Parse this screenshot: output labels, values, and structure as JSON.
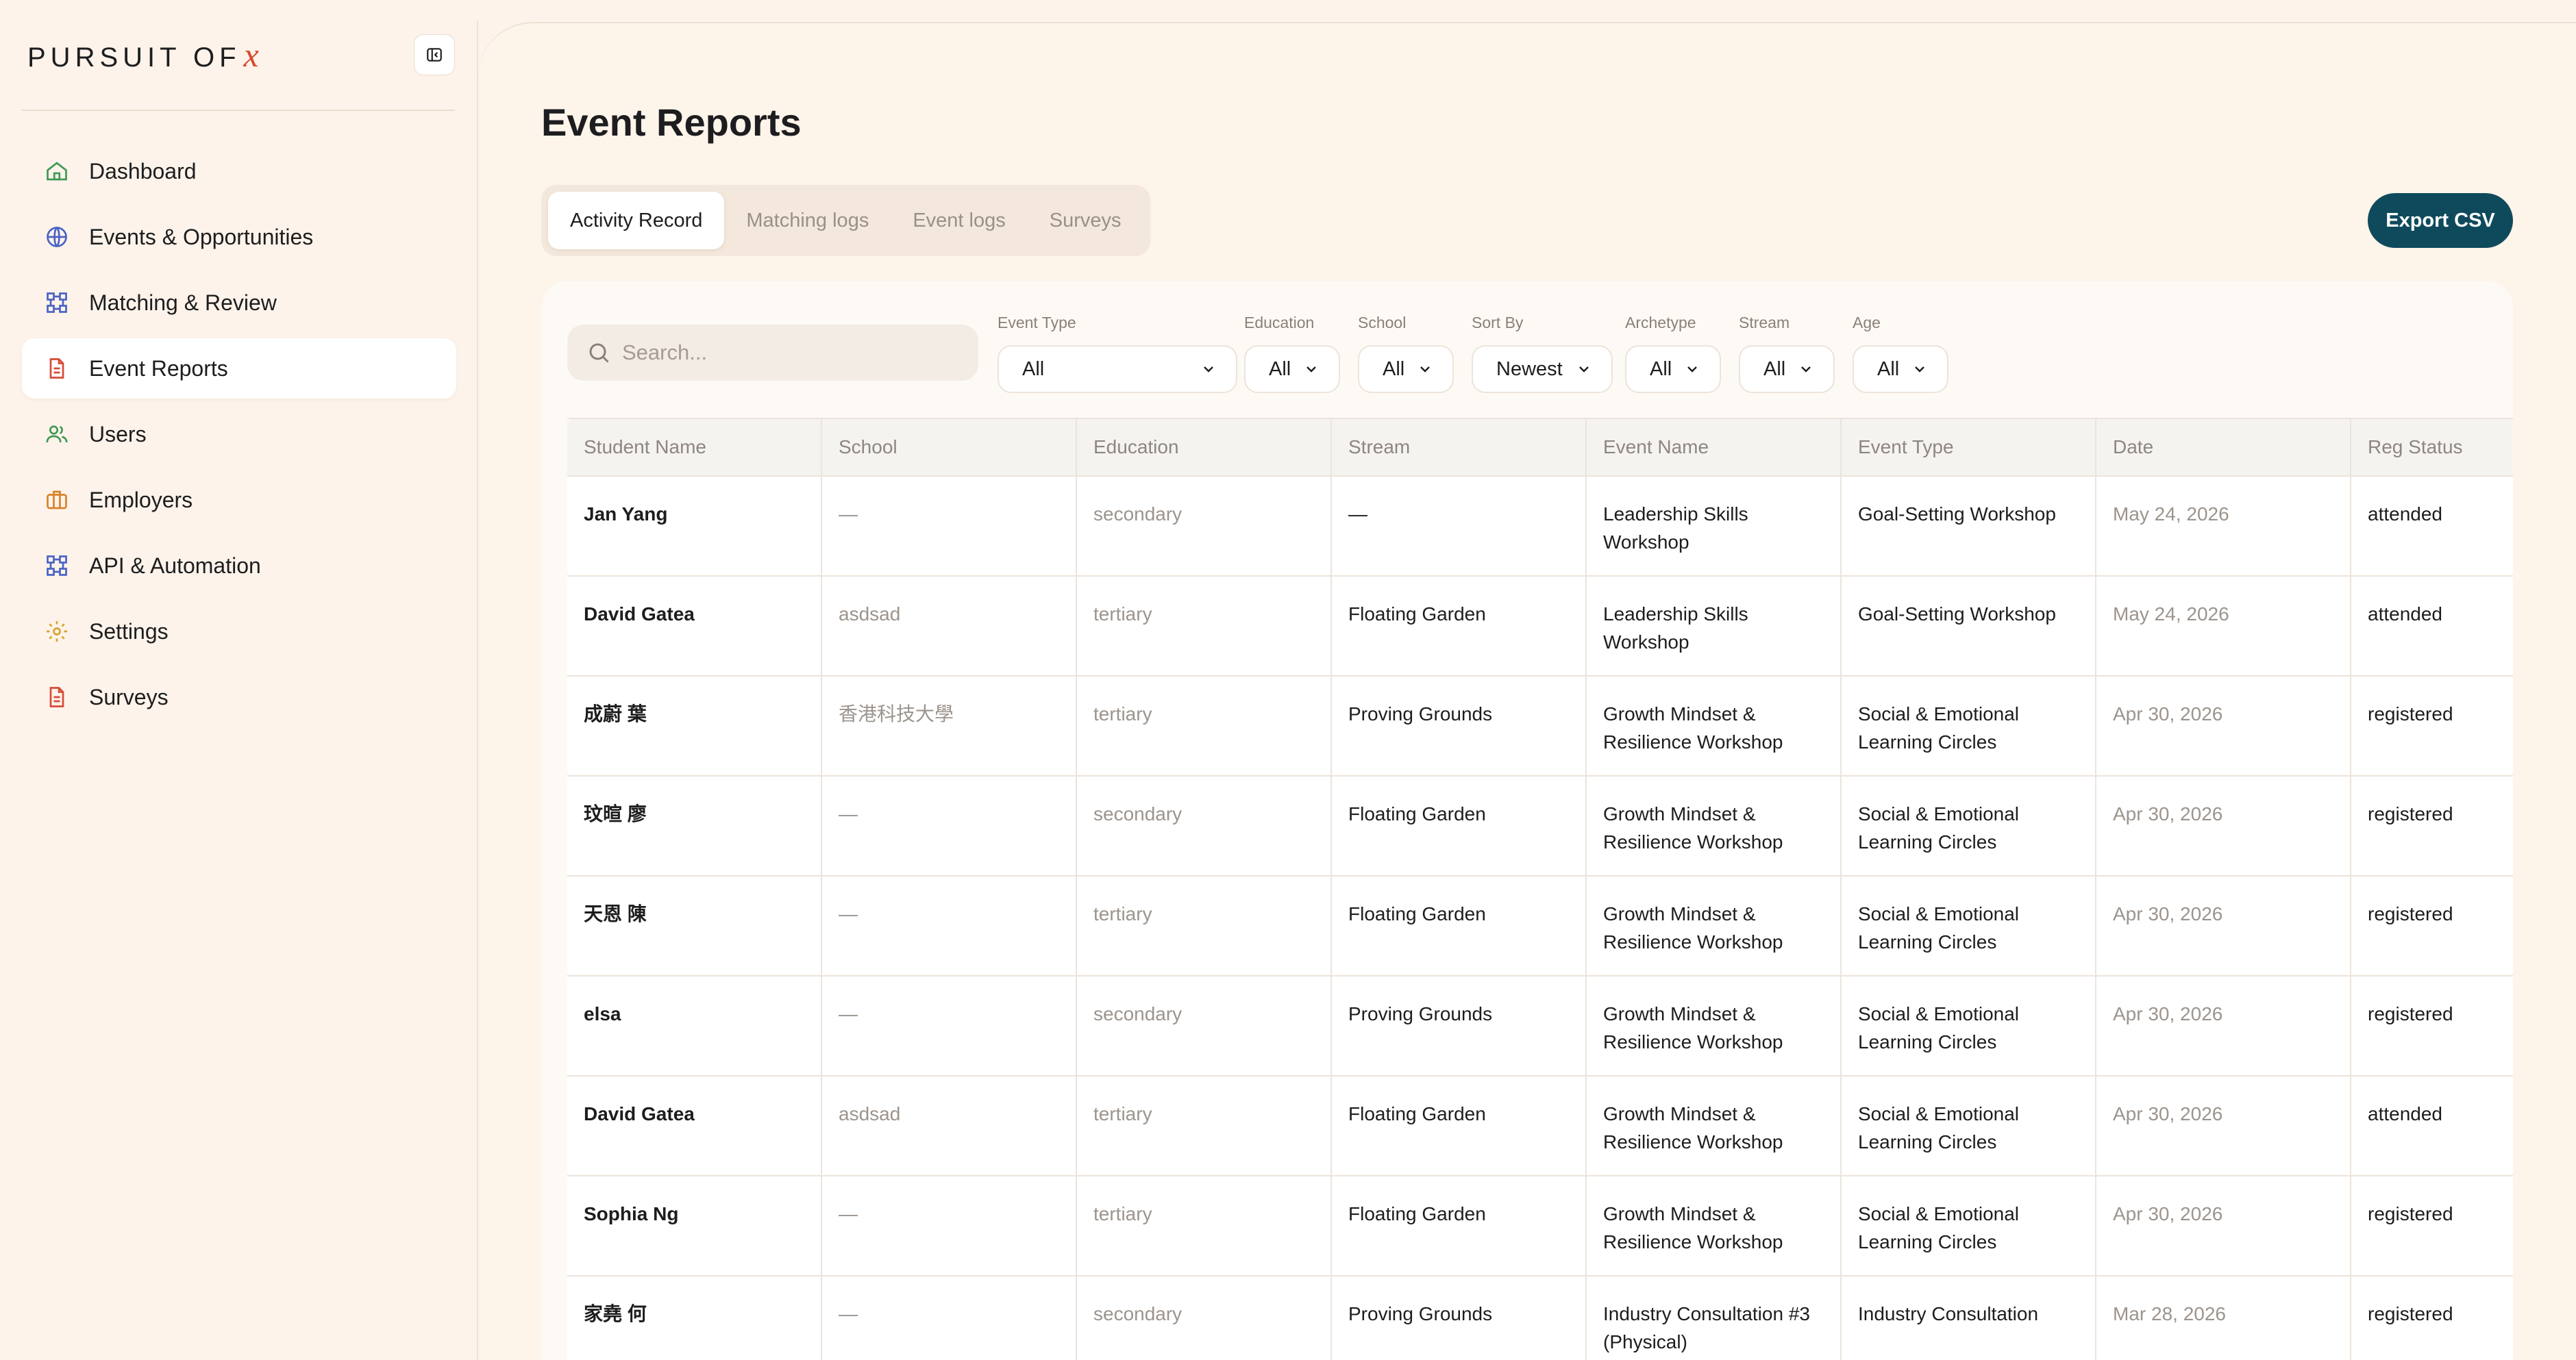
{
  "brand": {
    "name": "PURSUIT OF",
    "mark": "x"
  },
  "sidebar": {
    "items": [
      {
        "label": "Dashboard",
        "icon": "home-icon",
        "active": false
      },
      {
        "label": "Events & Opportunities",
        "icon": "globe-icon",
        "active": false
      },
      {
        "label": "Matching & Review",
        "icon": "network-icon",
        "active": false
      },
      {
        "label": "Event Reports",
        "icon": "document-icon",
        "active": true
      },
      {
        "label": "Users",
        "icon": "users-icon",
        "active": false
      },
      {
        "label": "Employers",
        "icon": "briefcase-icon",
        "active": false
      },
      {
        "label": "API & Automation",
        "icon": "network-icon",
        "active": false
      },
      {
        "label": "Settings",
        "icon": "gear-icon",
        "active": false
      },
      {
        "label": "Surveys",
        "icon": "document-icon",
        "active": false
      }
    ]
  },
  "page": {
    "title": "Event Reports",
    "export_label": "Export CSV"
  },
  "tabs": [
    {
      "label": "Activity Record",
      "active": true
    },
    {
      "label": "Matching logs",
      "active": false
    },
    {
      "label": "Event logs",
      "active": false
    },
    {
      "label": "Surveys",
      "active": false
    }
  ],
  "search": {
    "placeholder": "Search..."
  },
  "filters": [
    {
      "label": "Event Type",
      "value": "All"
    },
    {
      "label": "Education",
      "value": "All"
    },
    {
      "label": "School",
      "value": "All"
    },
    {
      "label": "Sort By",
      "value": "Newest"
    },
    {
      "label": "Archetype",
      "value": "All"
    },
    {
      "label": "Stream",
      "value": "All"
    },
    {
      "label": "Age",
      "value": "All"
    }
  ],
  "table": {
    "columns": [
      "Student Name",
      "School",
      "Education",
      "Stream",
      "Event Name",
      "Event Type",
      "Date",
      "Reg Status"
    ],
    "rows": [
      [
        "Jan Yang",
        "—",
        "secondary",
        "—",
        "Leadership Skills Workshop",
        "Goal-Setting Workshop",
        "May 24, 2026",
        "attended"
      ],
      [
        "David Gatea",
        "asdsad",
        "tertiary",
        "Floating Garden",
        "Leadership Skills Workshop",
        "Goal-Setting Workshop",
        "May 24, 2026",
        "attended"
      ],
      [
        "成蔚 葉",
        "香港科技大學",
        "tertiary",
        "Proving Grounds",
        "Growth Mindset & Resilience Workshop",
        "Social & Emotional Learning Circles",
        "Apr 30, 2026",
        "registered"
      ],
      [
        "玟暄 廖",
        "—",
        "secondary",
        "Floating Garden",
        "Growth Mindset & Resilience Workshop",
        "Social & Emotional Learning Circles",
        "Apr 30, 2026",
        "registered"
      ],
      [
        "天恩 陳",
        "—",
        "tertiary",
        "Floating Garden",
        "Growth Mindset & Resilience Workshop",
        "Social & Emotional Learning Circles",
        "Apr 30, 2026",
        "registered"
      ],
      [
        "elsa",
        "—",
        "secondary",
        "Proving Grounds",
        "Growth Mindset & Resilience Workshop",
        "Social & Emotional Learning Circles",
        "Apr 30, 2026",
        "registered"
      ],
      [
        "David Gatea",
        "asdsad",
        "tertiary",
        "Floating Garden",
        "Growth Mindset & Resilience Workshop",
        "Social & Emotional Learning Circles",
        "Apr 30, 2026",
        "attended"
      ],
      [
        "Sophia Ng",
        "—",
        "tertiary",
        "Floating Garden",
        "Growth Mindset & Resilience Workshop",
        "Social & Emotional Learning Circles",
        "Apr 30, 2026",
        "registered"
      ],
      [
        "家堯 何",
        "—",
        "secondary",
        "Proving Grounds",
        "Industry Consultation #3 (Physical)",
        "Industry Consultation",
        "Mar 28, 2026",
        "registered"
      ]
    ]
  },
  "colors": {
    "accent": "#0f4a5c",
    "brand_x": "#d44a2a",
    "background": "#fdf3ea"
  }
}
